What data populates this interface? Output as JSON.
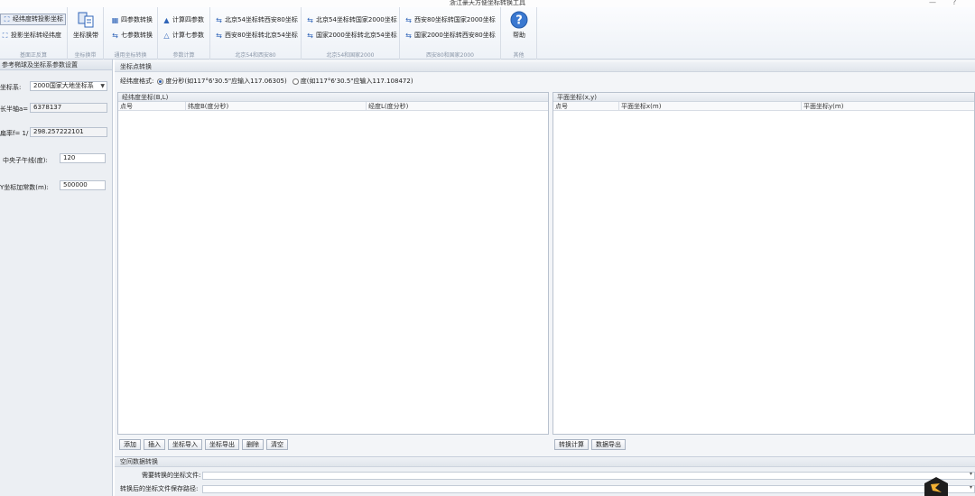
{
  "window": {
    "title": "浙江豪天方便坐标转换工具",
    "min_glyph": "—",
    "restore_glyph": "?"
  },
  "ribbon": {
    "groups": [
      {
        "label": "基面正反算",
        "items": [
          "经纬度转投影坐标",
          "投影坐标转经纬度"
        ]
      },
      {
        "label": "坐标换带",
        "items": [
          "坐标换带"
        ]
      },
      {
        "label": "通用坐标转换",
        "items": [
          "四参数转换",
          "七参数转换"
        ]
      },
      {
        "label": "参数计算",
        "items": [
          "计算四参数",
          "计算七参数"
        ]
      },
      {
        "label": "北京54和西安80",
        "items": [
          "北京54坐标转西安80坐标",
          "西安80坐标转北京54坐标"
        ]
      },
      {
        "label": "北京54和国家2000",
        "items": [
          "北京54坐标转国家2000坐标",
          "国家2000坐标转北京54坐标"
        ]
      },
      {
        "label": "西安80和国家2000",
        "items": [
          "西安80坐标转国家2000坐标",
          "国家2000坐标转西安80坐标"
        ]
      },
      {
        "label": "其他",
        "items": [
          "帮助"
        ]
      }
    ]
  },
  "left_panel": {
    "title": "参考椭球及坐标系参数设置",
    "coord_system_label": "坐标系:",
    "coord_system_value": "2000国家大地坐标系",
    "semi_major_label": "长半轴a=",
    "semi_major_value": "6378137",
    "flattening_label": "扁率f= 1/",
    "flattening_value": "298.257222101",
    "central_meridian_label": "中央子午线(度):",
    "central_meridian_value": "120",
    "y_add_label": "Y坐标加常数(m):",
    "y_add_value": "500000"
  },
  "main": {
    "section_title": "坐标点转换",
    "format_label": "经纬度格式:",
    "format_option_1": "度分秒(如117°6'30.5\"应输入117.06305)",
    "format_option_2": "度(如117°6'30.5\"应输入117.108472)",
    "left_grid": {
      "title": "经纬度坐标(B,L)",
      "columns": [
        "点号",
        "纬度B(度分秒)",
        "经度L(度分秒)"
      ],
      "buttons": [
        "添加",
        "插入",
        "坐标导入",
        "坐标导出",
        "删除",
        "清空"
      ]
    },
    "right_grid": {
      "title": "平面坐标(x,y)",
      "columns": [
        "点号",
        "平面坐标x(m)",
        "平面坐标y(m)"
      ],
      "buttons": [
        "转换计算",
        "数据导出"
      ]
    },
    "spatial": {
      "title": "空间数据转换",
      "input_label": "需要转换的坐标文件:",
      "output_label": "转换后的坐标文件保存路径:"
    }
  },
  "colors": {
    "accent": "#2f64b8",
    "help_icon": "#3a78d0",
    "panel_bg": "#eceff3"
  }
}
